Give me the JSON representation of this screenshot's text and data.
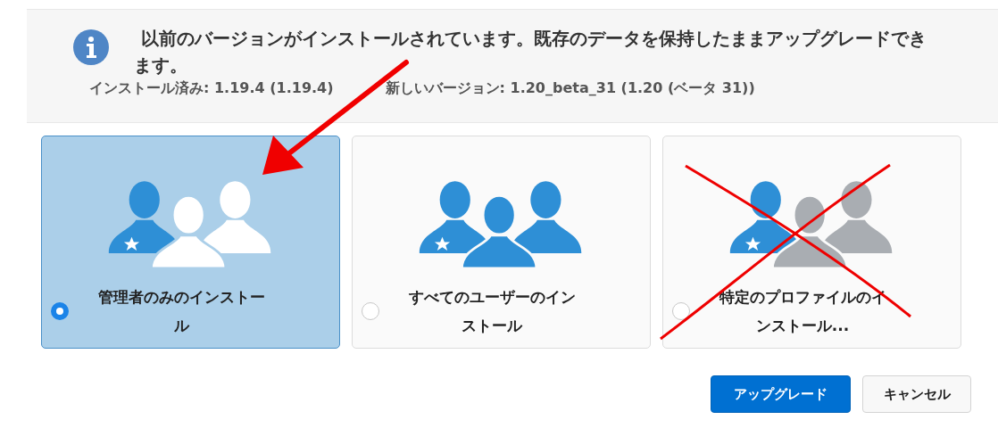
{
  "notice": {
    "message": "以前のバージョンがインストールされています。既存のデータを保持したままアップグレードできます。",
    "installed": "インストール済み: 1.19.4 (1.19.4)",
    "new_version": "新しいバージョン: 1.20_beta_31 (1.20 (ベータ 31))"
  },
  "options": [
    {
      "kind": "admins",
      "label": "管理者のみのインストール",
      "selected": true
    },
    {
      "kind": "all_users",
      "label": "すべてのユーザーのインストール",
      "selected": false
    },
    {
      "kind": "profiles",
      "label": "特定のプロファイルのインストール...",
      "selected": false
    }
  ],
  "buttons": [
    {
      "kind": "primary",
      "label": "アップグレード"
    },
    {
      "kind": "secondary",
      "label": "キャンセル"
    }
  ]
}
